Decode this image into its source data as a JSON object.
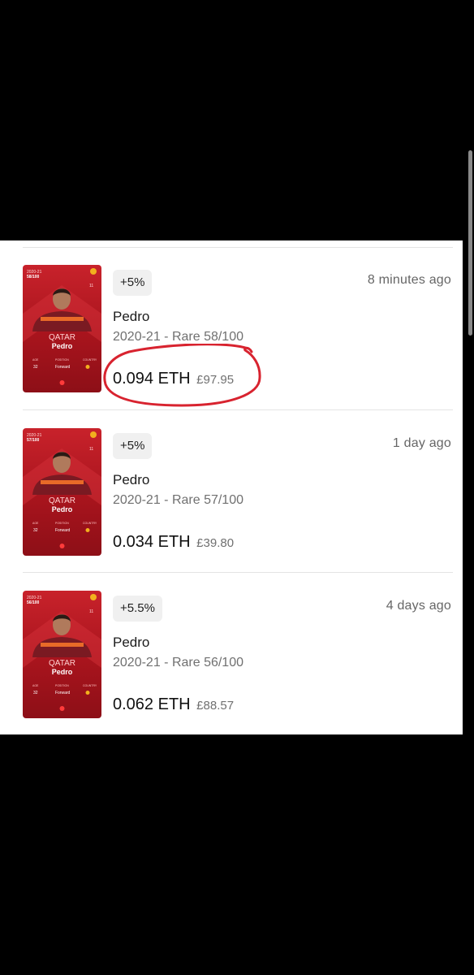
{
  "sales": [
    {
      "badge": "+5%",
      "time_ago": "8 minutes ago",
      "player": "Pedro",
      "rarity": "2020-21 - Rare 58/100",
      "price_eth": "0.094 ETH",
      "price_fiat": "£97.95",
      "highlighted": true,
      "card": {
        "season": "2020-21",
        "serial": "58/100",
        "name": "Pedro",
        "sponsor": "QATAR",
        "age_label": "AGE",
        "age": "32",
        "position_label": "POSITION",
        "position": "Forward",
        "country_label": "COUNTRY",
        "number": "11"
      }
    },
    {
      "badge": "+5%",
      "time_ago": "1 day ago",
      "player": "Pedro",
      "rarity": "2020-21 - Rare 57/100",
      "price_eth": "0.034 ETH",
      "price_fiat": "£39.80",
      "highlighted": false,
      "card": {
        "season": "2020-21",
        "serial": "57/100",
        "name": "Pedro",
        "sponsor": "QATAR",
        "age_label": "AGE",
        "age": "32",
        "position_label": "POSITION",
        "position": "Forward",
        "country_label": "COUNTRY",
        "number": "11"
      }
    },
    {
      "badge": "+5.5%",
      "time_ago": "4 days ago",
      "player": "Pedro",
      "rarity": "2020-21 - Rare 56/100",
      "price_eth": "0.062 ETH",
      "price_fiat": "£88.57",
      "highlighted": false,
      "card": {
        "season": "2020-21",
        "serial": "56/100",
        "name": "Pedro",
        "sponsor": "QATAR",
        "age_label": "AGE",
        "age": "32",
        "position_label": "POSITION",
        "position": "Forward",
        "country_label": "COUNTRY",
        "number": "11"
      }
    }
  ],
  "colors": {
    "card_red": "#c8222b",
    "annotation_red": "#d8232f",
    "text_muted": "#707070"
  }
}
